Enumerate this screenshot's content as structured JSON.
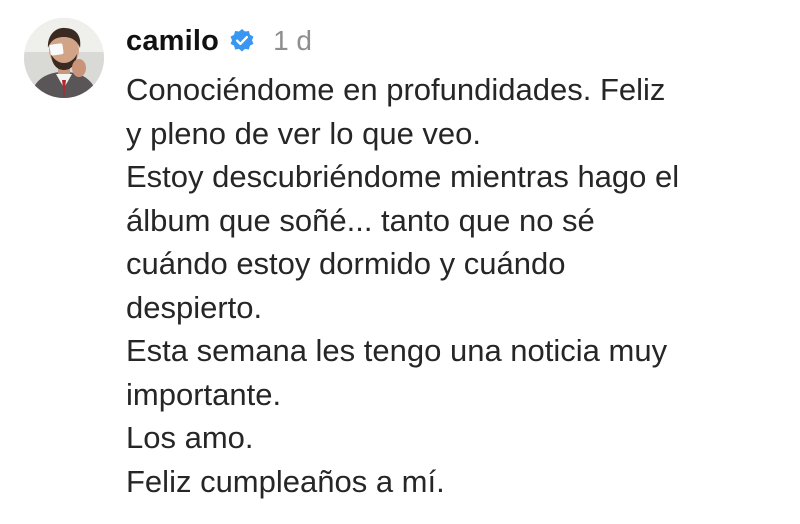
{
  "post": {
    "avatar_icon": "profile-photo",
    "username": "camilo",
    "verified_icon": "verified-badge-icon",
    "verified_color": "#3897f0",
    "time": "1 d",
    "caption_lines": [
      "Conociéndome en profundidades. Feliz",
      "y pleno de ver lo que veo.",
      "Estoy descubriéndome mientras hago el",
      "álbum que soñé... tanto que no sé",
      "cuándo estoy dormido y cuándo",
      "despierto.",
      "Esta semana les tengo una noticia muy",
      "importante.",
      "Los amo.",
      "Feliz cumpleaños a mí."
    ]
  }
}
